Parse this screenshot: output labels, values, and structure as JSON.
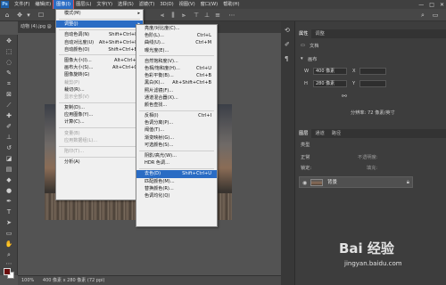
{
  "menubar": {
    "logo": "Ps",
    "items": [
      "文件(F)",
      "编辑(E)",
      "图像(I)",
      "图层(L)",
      "文字(Y)",
      "选择(S)",
      "滤镜(T)",
      "3D(D)",
      "视图(V)",
      "窗口(W)",
      "帮助(H)"
    ],
    "active_index": 2,
    "window_controls": [
      "—",
      "□",
      "✕"
    ]
  },
  "document": {
    "tab_label": "动物 (4).jpg @",
    "status": "100%",
    "size_info": "400 像素 x 280 像素 (72 ppi)"
  },
  "image_menu": {
    "items": [
      {
        "label": "模式(M)",
        "shortcut": "",
        "submenu": true,
        "disabled": false
      },
      {
        "sep": true
      },
      {
        "label": "调整(J)",
        "shortcut": "",
        "submenu": true,
        "disabled": false,
        "highlight": true
      },
      {
        "sep": true
      },
      {
        "label": "自动色调(N)",
        "shortcut": "Shift+Ctrl+L",
        "disabled": false
      },
      {
        "label": "自动对比度(U)",
        "shortcut": "Alt+Shift+Ctrl+L",
        "disabled": false
      },
      {
        "label": "自动颜色(O)",
        "shortcut": "Shift+Ctrl+B",
        "disabled": false
      },
      {
        "sep": true
      },
      {
        "label": "图像大小(I)...",
        "shortcut": "Alt+Ctrl+I",
        "disabled": false
      },
      {
        "label": "画布大小(S)...",
        "shortcut": "Alt+Ctrl+C",
        "disabled": false
      },
      {
        "label": "图像旋转(G)",
        "shortcut": "",
        "submenu": true,
        "disabled": false
      },
      {
        "label": "裁剪(P)",
        "shortcut": "",
        "disabled": true
      },
      {
        "label": "裁切(R)...",
        "shortcut": "",
        "disabled": false
      },
      {
        "label": "显示全部(V)",
        "shortcut": "",
        "disabled": true
      },
      {
        "sep": true
      },
      {
        "label": "复制(D)...",
        "shortcut": "",
        "disabled": false
      },
      {
        "label": "应用图像(Y)...",
        "shortcut": "",
        "disabled": false
      },
      {
        "label": "计算(C)...",
        "shortcut": "",
        "disabled": false
      },
      {
        "sep": true
      },
      {
        "label": "变量(B)",
        "shortcut": "",
        "submenu": true,
        "disabled": true
      },
      {
        "label": "应用数据组(L)...",
        "shortcut": "",
        "disabled": true
      },
      {
        "sep": true
      },
      {
        "label": "陷印(T)...",
        "shortcut": "",
        "disabled": true
      },
      {
        "sep": true
      },
      {
        "label": "分析(A)",
        "shortcut": "",
        "submenu": true,
        "disabled": false
      }
    ]
  },
  "adjust_menu": {
    "items": [
      {
        "label": "亮度/对比度(C)...",
        "shortcut": ""
      },
      {
        "label": "色阶(L)...",
        "shortcut": "Ctrl+L"
      },
      {
        "label": "曲线(U)...",
        "shortcut": "Ctrl+M"
      },
      {
        "label": "曝光度(E)...",
        "shortcut": ""
      },
      {
        "sep": true
      },
      {
        "label": "自然饱和度(V)...",
        "shortcut": ""
      },
      {
        "label": "色相/饱和度(H)...",
        "shortcut": "Ctrl+U"
      },
      {
        "label": "色彩平衡(B)...",
        "shortcut": "Ctrl+B"
      },
      {
        "label": "黑白(K)...",
        "shortcut": "Alt+Shift+Ctrl+B"
      },
      {
        "label": "照片滤镜(F)...",
        "shortcut": ""
      },
      {
        "label": "通道混合器(X)...",
        "shortcut": ""
      },
      {
        "label": "颜色查找...",
        "shortcut": ""
      },
      {
        "sep": true
      },
      {
        "label": "反相(I)",
        "shortcut": "Ctrl+I"
      },
      {
        "label": "色调分离(P)...",
        "shortcut": ""
      },
      {
        "label": "阈值(T)...",
        "shortcut": ""
      },
      {
        "label": "渐变映射(G)...",
        "shortcut": ""
      },
      {
        "label": "可选颜色(S)...",
        "shortcut": ""
      },
      {
        "sep": true
      },
      {
        "label": "阴影/高光(W)...",
        "shortcut": ""
      },
      {
        "label": "HDR 色调...",
        "shortcut": ""
      },
      {
        "sep": true
      },
      {
        "label": "去色(D)",
        "shortcut": "Shift+Ctrl+U",
        "highlight": true
      },
      {
        "label": "匹配颜色(M)...",
        "shortcut": ""
      },
      {
        "label": "替换颜色(R)...",
        "shortcut": ""
      },
      {
        "label": "色调均化(Q)",
        "shortcut": ""
      }
    ]
  },
  "properties_panel": {
    "tabs": [
      "属性",
      "调整"
    ],
    "section": "文档",
    "subsection": "画布",
    "width_label": "W",
    "width_value": "400 像素",
    "height_label": "H",
    "height_value": "280 像素",
    "x_label": "X",
    "y_label": "Y",
    "resolution": "分辨率: 72 像素/英寸"
  },
  "layers_panel": {
    "tabs": [
      "图层",
      "通道",
      "路径"
    ],
    "kind_label": "类型",
    "blend_mode": "正常",
    "opacity_label": "不透明度:",
    "lock_label": "锁定:",
    "fill_label": "填充:",
    "layer_name": "背景"
  },
  "watermark": {
    "main": "Bai 经验",
    "sub": "jingyan.baidu.com"
  },
  "colors": {
    "foreground": "#6a0d0d",
    "background": "#ffffff",
    "highlight": "#2a6cc4"
  }
}
